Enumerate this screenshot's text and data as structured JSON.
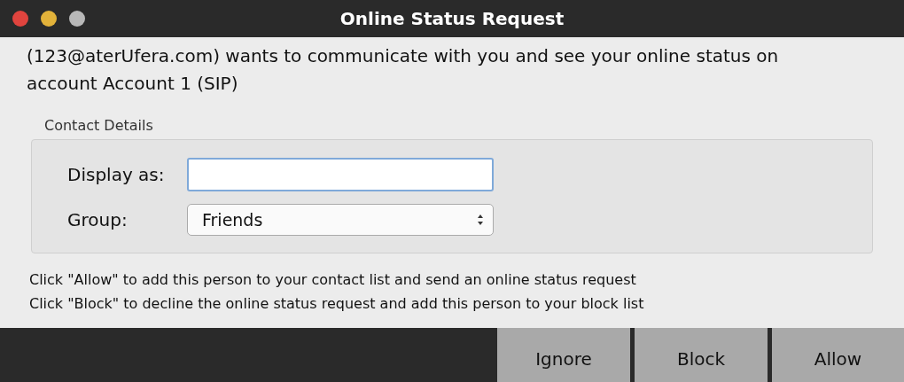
{
  "window": {
    "title": "Online Status Request"
  },
  "message": "(123@aterUfera.com) wants to communicate with you and see your online status on account  Account 1 (SIP)",
  "contact_details": {
    "title": "Contact Details",
    "display_as": {
      "label": "Display as:"
    },
    "group": {
      "label": "Group:",
      "value": "Friends"
    }
  },
  "instructions": [
    "Click \"Allow\" to add this person to your contact list and send an online status request",
    "Click \"Block\" to decline the online status request and add this person to your block list"
  ],
  "buttons": [
    "Ignore",
    "Block",
    "Allow"
  ]
}
